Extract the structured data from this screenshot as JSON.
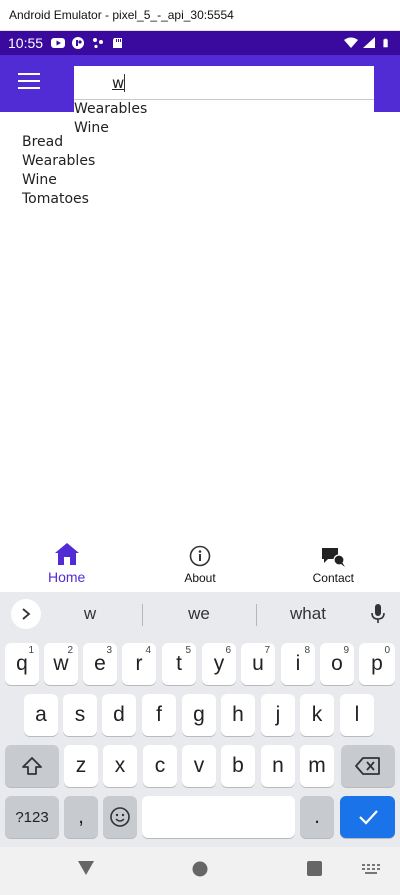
{
  "window": {
    "title": "Android Emulator - pixel_5_-_api_30:5554"
  },
  "status_bar": {
    "time": "10:55",
    "background": "#3a0a9e"
  },
  "app_bar": {
    "background": "#512bd4",
    "menu_icon": "hamburger-icon"
  },
  "search": {
    "value": "w"
  },
  "suggestions": [
    "Wearables",
    "Wine"
  ],
  "list": [
    "Bread",
    "Wearables",
    "Wine",
    "Tomatoes"
  ],
  "tabs": [
    {
      "label": "Home",
      "icon": "home-icon",
      "active": true
    },
    {
      "label": "About",
      "icon": "info-icon",
      "active": false
    },
    {
      "label": "Contact",
      "icon": "chat-icon",
      "active": false
    }
  ],
  "keyboard": {
    "suggestions": [
      "w",
      "we",
      "what"
    ],
    "row1": [
      {
        "key": "q",
        "hint": "1"
      },
      {
        "key": "w",
        "hint": "2"
      },
      {
        "key": "e",
        "hint": "3"
      },
      {
        "key": "r",
        "hint": "4"
      },
      {
        "key": "t",
        "hint": "5"
      },
      {
        "key": "y",
        "hint": "6"
      },
      {
        "key": "u",
        "hint": "7"
      },
      {
        "key": "i",
        "hint": "8"
      },
      {
        "key": "o",
        "hint": "9"
      },
      {
        "key": "p",
        "hint": "0"
      }
    ],
    "row2": [
      "a",
      "s",
      "d",
      "f",
      "g",
      "h",
      "j",
      "k",
      "l"
    ],
    "row3": [
      "z",
      "x",
      "c",
      "v",
      "b",
      "n",
      "m"
    ],
    "symbols_label": "?123",
    "comma_label": ",",
    "period_label": ".",
    "accent_color": "#1a73e8"
  }
}
